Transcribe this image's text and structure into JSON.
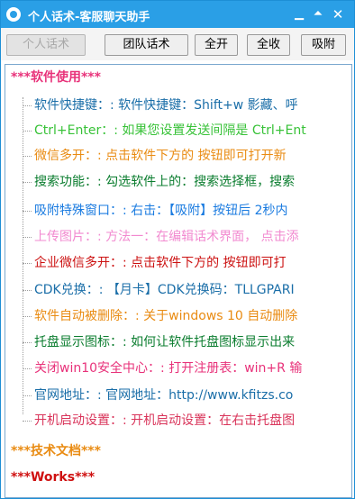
{
  "window": {
    "title": "个人话术-客服聊天助手"
  },
  "titlebar_buttons": {
    "min": "▁",
    "max": "⏶",
    "close": "✕"
  },
  "toolbar": {
    "tabs": [
      {
        "label": "个人话术",
        "disabled": true
      },
      {
        "label": "团队话术",
        "disabled": false
      },
      {
        "label": "全开",
        "disabled": false
      },
      {
        "label": "全收",
        "disabled": false
      },
      {
        "label": "吸附",
        "disabled": false
      }
    ]
  },
  "tree": {
    "categories": [
      {
        "label": "***软件使用***",
        "color": "#e8327a"
      },
      {
        "label": "***技术文档***",
        "color": "#e98b12"
      },
      {
        "label": "***Works***",
        "color": "#cf1010"
      }
    ],
    "items": [
      {
        "text": "软件快捷键：: 软件快捷键：Shift+w 影藏、呼",
        "color": "#1a6ea8"
      },
      {
        "text": "Ctrl+Enter：: 如果您设置发送间隔是 Ctrl+Ent",
        "color": "#38c238"
      },
      {
        "text": "微信多开：: 点击软件下方的  按钮即可打开新",
        "color": "#e98b12"
      },
      {
        "text": "搜索功能：: 勾选软件上的：搜索选择框，搜索",
        "color": "#0b7d2f"
      },
      {
        "text": "吸附特殊窗口：: 右击：【吸附】按钮后  2秒内",
        "color": "#1a7be0"
      },
      {
        "text": "上传图片：: 方法一：在编辑话术界面，    点击添",
        "color": "#f28ad0"
      },
      {
        "text": "企业微信多开：: 点击软件下方的  按钮即可打",
        "color": "#cc1111"
      },
      {
        "text": "CDK兑换：: 【月卡】CDK兑换码：TLLGPARI",
        "color": "#1a6ea8"
      },
      {
        "text": "软件自动被删除：: 关于windows 10 自动删除",
        "color": "#e98b12"
      },
      {
        "text": "托盘显示图标：: 如何让软件托盘图标显示出来",
        "color": "#0b7d2f"
      },
      {
        "text": "关闭win10安全中心：: 打开注册表：win+R 输",
        "color": "#e8327a"
      },
      {
        "text": "官网地址：: 官网地址：http://www.kfitzs.co",
        "color": "#1a6ea8"
      },
      {
        "text": "开机启动设置：: 开机启动设置：在右击托盘图",
        "color": "#d9345a"
      }
    ]
  }
}
